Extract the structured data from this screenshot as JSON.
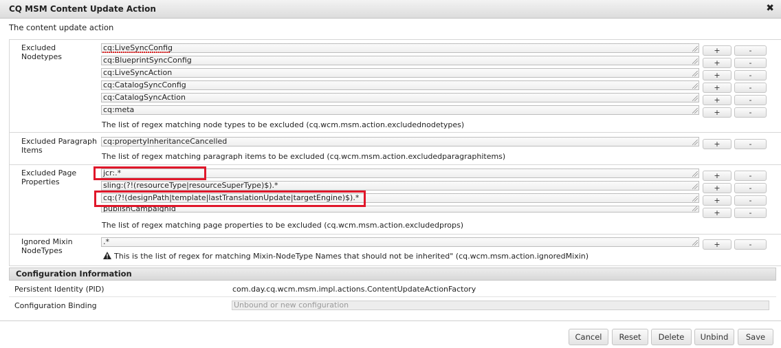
{
  "dialog": {
    "title": "CQ MSM Content Update Action",
    "description": "The content update action"
  },
  "excluded_nodetypes": {
    "label": "Excluded Nodetypes",
    "values": [
      "cq:LiveSyncConfig",
      "cq:BlueprintSyncConfig",
      "cq:LiveSyncAction",
      "cq:CatalogSyncConfig",
      "cq:CatalogSyncAction",
      "cq:meta"
    ],
    "help": "The list of regex matching node types to be excluded (cq.wcm.msm.action.excludednodetypes)"
  },
  "excluded_paragraph_items": {
    "label": "Excluded Paragraph Items",
    "values": [
      "cq:propertyInheritanceCancelled"
    ],
    "help": "The list of regex matching paragraph items to be excluded (cq.wcm.msm.action.excludedparagraphitems)"
  },
  "excluded_page_properties": {
    "label": "Excluded Page Properties",
    "values": [
      "jcr:.*",
      "sling:(?!(resourceType|resourceSuperType)$).*",
      "cq:(?!(designPath|template|lastTranslationUpdate|targetEngine)$).*",
      "publishCampaignId"
    ],
    "help": "The list of regex matching page properties to be excluded (cq.wcm.msm.action.excludedprops)"
  },
  "ignored_mixin": {
    "label": "Ignored Mixin NodeTypes",
    "values": [
      ".*"
    ],
    "help": "This is the list of regex for matching Mixin-NodeType Names that should not be inherited\" (cq.wcm.msm.action.ignoredMixin)"
  },
  "add_label": "+",
  "remove_label": "-",
  "config": {
    "header": "Configuration Information",
    "pid_label": "Persistent Identity (PID)",
    "pid_value": "com.day.cq.wcm.msm.impl.actions.ContentUpdateActionFactory",
    "binding_label": "Configuration Binding",
    "binding_placeholder": "Unbound or new configuration"
  },
  "buttons": {
    "cancel": "Cancel",
    "reset": "Reset",
    "delete": "Delete",
    "unbind": "Unbind",
    "save": "Save"
  },
  "icons": {
    "close": "close-icon",
    "warning": "warning-icon",
    "resize": "resize-grip-icon"
  },
  "colors": {
    "highlight": "#e0172a"
  }
}
